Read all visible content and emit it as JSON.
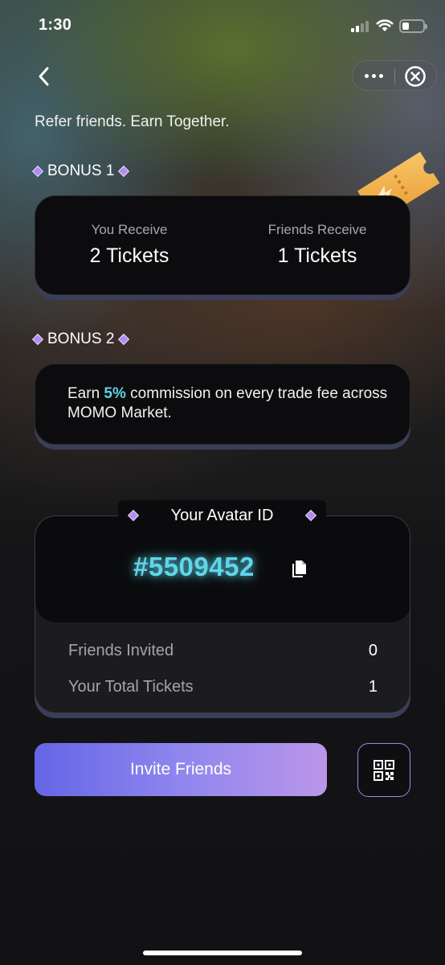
{
  "status_bar": {
    "time": "1:30"
  },
  "nav": {
    "back_icon": "chevron-left-icon",
    "more_icon": "more-dots-icon",
    "close_icon": "close-circle-icon"
  },
  "header": {
    "subtitle": "Refer friends. Earn Together."
  },
  "bonus1": {
    "title": "BONUS 1",
    "you_receive_label": "You Receive",
    "you_receive_value": "2 Tickets",
    "friends_receive_label": "Friends Receive",
    "friends_receive_value": "1 Tickets"
  },
  "bonus2": {
    "title": "BONUS 2",
    "text_before": "Earn ",
    "percent": "5%",
    "text_after": " commission on every trade fee across MOMO Market."
  },
  "avatar": {
    "label": "Your Avatar ID",
    "id": "#5509452",
    "copy_icon": "copy-icon"
  },
  "stats": [
    {
      "label": "Friends Invited",
      "value": "0"
    },
    {
      "label": "Your Total Tickets",
      "value": "1"
    }
  ],
  "actions": {
    "invite_label": "Invite Friends",
    "qr_icon": "qr-code-icon"
  },
  "colors": {
    "accent_cyan": "#5fd6ea",
    "gradient_start": "#6566e6",
    "gradient_end": "#ba96ea",
    "diamond": "#b08cf0"
  }
}
